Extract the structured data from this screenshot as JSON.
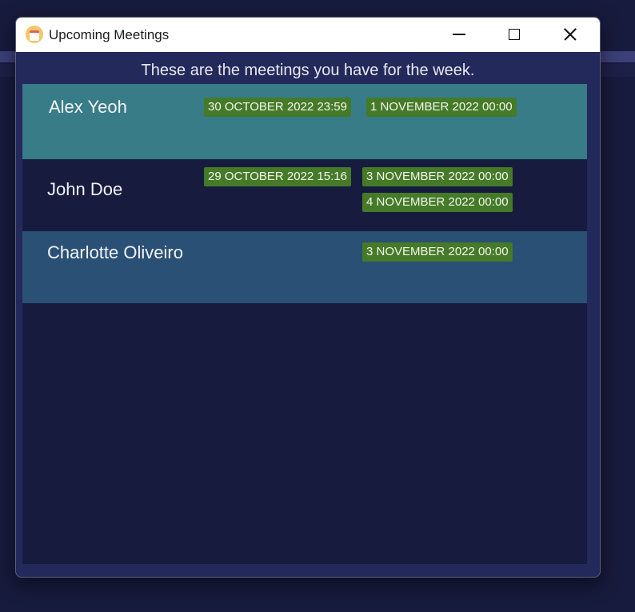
{
  "window": {
    "title": "Upcoming Meetings",
    "icon": "calendar-icon"
  },
  "header": {
    "text": "These are the meetings you have for the week."
  },
  "meetings": [
    {
      "name": "Alex Yeoh",
      "dates": [
        "30 OCTOBER 2022 23:59",
        "1 NOVEMBER 2022 00:00"
      ]
    },
    {
      "name": "John Doe",
      "dates": [
        "29 OCTOBER 2022 15:16",
        "3 NOVEMBER 2022 00:00",
        "4 NOVEMBER 2022 00:00"
      ]
    },
    {
      "name": "Charlotte Oliveiro",
      "dates": [
        "3 NOVEMBER 2022 00:00"
      ]
    }
  ],
  "colors": {
    "row_selected": "#387c88",
    "row_default": "#171c3e",
    "row_alt": "#2a5075",
    "tag": "#457a28"
  }
}
